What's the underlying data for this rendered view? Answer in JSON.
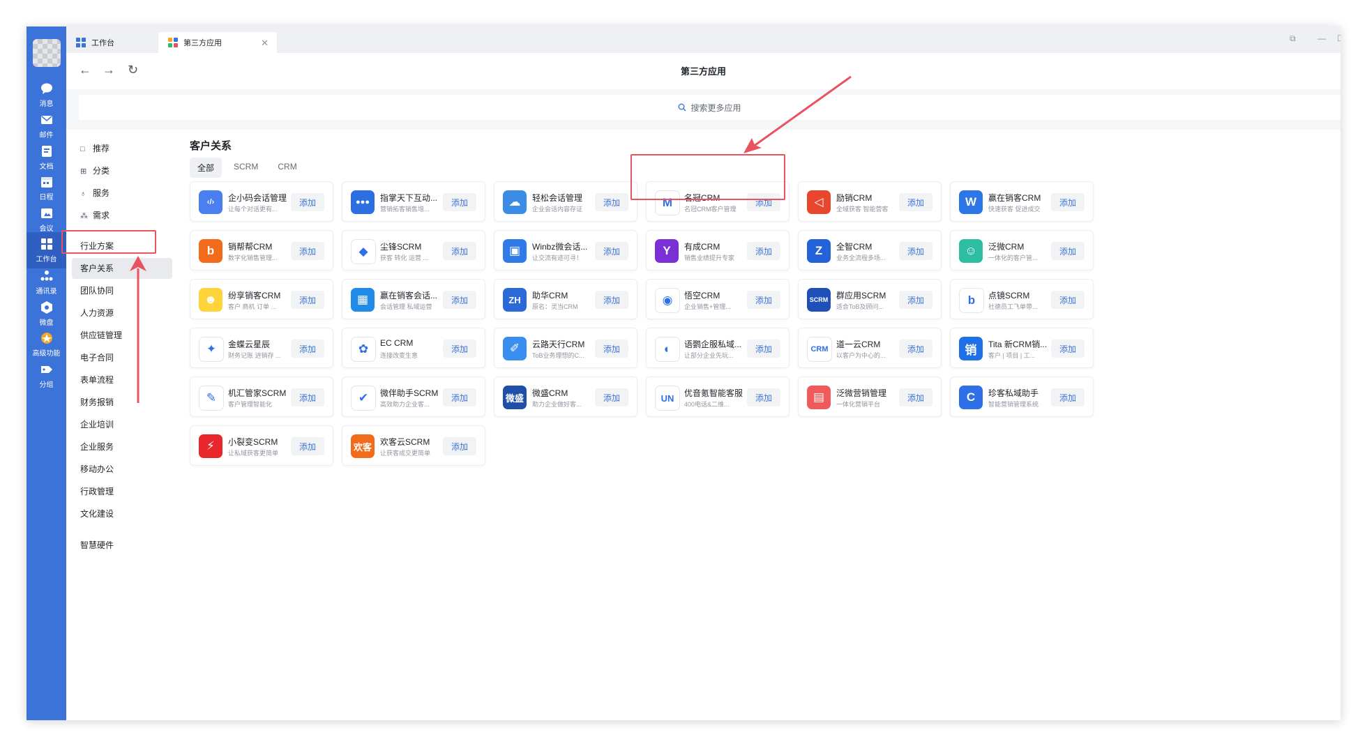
{
  "rail": {
    "items": [
      {
        "label": "消息",
        "icon": "chat-bubble-icon"
      },
      {
        "label": "邮件",
        "icon": "mail-icon"
      },
      {
        "label": "文档",
        "icon": "document-icon"
      },
      {
        "label": "日程",
        "icon": "calendar-icon"
      },
      {
        "label": "会议",
        "icon": "meeting-icon"
      },
      {
        "label": "工作台",
        "icon": "workbench-grid-icon"
      },
      {
        "label": "通讯录",
        "icon": "contacts-icon"
      },
      {
        "label": "微盘",
        "icon": "cloud-drive-icon"
      },
      {
        "label": "高级功能",
        "icon": "premium-icon"
      },
      {
        "label": "分组",
        "icon": "group-tag-icon"
      }
    ],
    "active_index": 5
  },
  "tabs": [
    {
      "label": "工作台"
    },
    {
      "label": "第三方应用",
      "closable": true
    }
  ],
  "window_controls": {
    "restore": "⧉",
    "minimize": "—",
    "maximize": "☐"
  },
  "nav": {
    "back": "←",
    "forward": "→",
    "refresh": "↻",
    "title": "第三方应用"
  },
  "search": {
    "placeholder": "搜索更多应用"
  },
  "sidebar": {
    "top_items": [
      {
        "label": "推荐",
        "icon": "□"
      },
      {
        "label": "分类",
        "icon": "⊞"
      },
      {
        "label": "服务",
        "icon": "♁"
      },
      {
        "label": "需求",
        "icon": "⁂"
      }
    ],
    "categories": [
      "行业方案",
      "客户关系",
      "团队协同",
      "人力资源",
      "供应链管理",
      "电子合同",
      "表单流程",
      "财务报销",
      "企业培训",
      "企业服务",
      "移动办公",
      "行政管理",
      "文化建设"
    ],
    "bottom_item": "智慧硬件",
    "active_category": "客户关系"
  },
  "main": {
    "title": "客户关系",
    "filters": [
      "全部",
      "SCRM",
      "CRM"
    ],
    "active_filter": "全部",
    "add_label": "添加",
    "apps": [
      {
        "name": "企小码会话管理",
        "desc": "让每个对话更有...",
        "color": "#4a7ff0",
        "glyph": "‹/›"
      },
      {
        "name": "指掌天下互动...",
        "desc": "营销拓客销售增...",
        "color": "#2c6fe0",
        "glyph": "●●●"
      },
      {
        "name": "轻松会话管理",
        "desc": "企业会话内容存证",
        "color": "#3b8ce6",
        "glyph": "☁"
      },
      {
        "name": "名冠CRM",
        "desc": "名冠CRM客户管理",
        "color": "#ffffff",
        "glyph": "M"
      },
      {
        "name": "励销CRM",
        "desc": "全域获客 智能营客",
        "color": "#e8472d",
        "glyph": "◁"
      },
      {
        "name": "赢在销客CRM",
        "desc": "快速获客 促进成交",
        "color": "#2c76e8",
        "glyph": "W"
      },
      {
        "name": "销帮帮CRM",
        "desc": "数字化销售管理...",
        "color": "#f26b1d",
        "glyph": "b"
      },
      {
        "name": "尘锋SCRM",
        "desc": "获客 转化 运营 ...",
        "color": "#ffffff",
        "glyph": "◆"
      },
      {
        "name": "Winbz微会话...",
        "desc": "让交流有迹可寻！",
        "color": "#2f7be8",
        "glyph": "▣"
      },
      {
        "name": "有成CRM",
        "desc": "销售业绩提升专家",
        "color": "#7b2fd6",
        "glyph": "Y"
      },
      {
        "name": "全智CRM",
        "desc": "业务全流程多场...",
        "color": "#2362d9",
        "glyph": "Z"
      },
      {
        "name": "泛微CRM",
        "desc": "一体化的客户管...",
        "color": "#2fbda3",
        "glyph": "☺"
      },
      {
        "name": "纷享销客CRM",
        "desc": "客户 商机 订单 ...",
        "color": "#ffd43b",
        "glyph": "☻"
      },
      {
        "name": "赢在销客会话...",
        "desc": "会话管理 私域运营",
        "color": "#1f8ae8",
        "glyph": "▦"
      },
      {
        "name": "助华CRM",
        "desc": "原名：灵当CRM",
        "color": "#2b6ad9",
        "glyph": "ZH"
      },
      {
        "name": "悟空CRM",
        "desc": "企业销售+管理...",
        "color": "#ffffff",
        "glyph": "◉"
      },
      {
        "name": "群应用SCRM",
        "desc": "适合ToB及顾问...",
        "color": "#1f4fb8",
        "glyph": "SCRM"
      },
      {
        "name": "点镜SCRM",
        "desc": "社德员工飞单带...",
        "color": "#ffffff",
        "glyph": "b"
      },
      {
        "name": "金蝶云星辰",
        "desc": "财务记账 进销存 ...",
        "color": "#ffffff",
        "glyph": "✦"
      },
      {
        "name": "EC CRM",
        "desc": "连接改变生意",
        "color": "#ffffff",
        "glyph": "✿"
      },
      {
        "name": "云路天行CRM",
        "desc": "ToB业务理想的C...",
        "color": "#3a8ef0",
        "glyph": "✐"
      },
      {
        "name": "语鹦企服私域...",
        "desc": "让部分企业先玩...",
        "color": "#ffffff",
        "glyph": "◐"
      },
      {
        "name": "道一云CRM",
        "desc": "以客户为中心的...",
        "color": "#ffffff",
        "glyph": "CRM"
      },
      {
        "name": "Tita 新CRM销...",
        "desc": "客户 | 项目 | 工...",
        "color": "#1f6fe8",
        "glyph": "销"
      },
      {
        "name": "机汇管家SCRM",
        "desc": "客户管理智能化",
        "color": "#ffffff",
        "glyph": "✎"
      },
      {
        "name": "微伴助手SCRM",
        "desc": "高效助力企业客...",
        "color": "#ffffff",
        "glyph": "✔"
      },
      {
        "name": "微盛CRM",
        "desc": "助力企业做好客...",
        "color": "#1f4fa8",
        "glyph": "微盛"
      },
      {
        "name": "优音氪智能客服",
        "desc": "400电话&二维...",
        "color": "#ffffff",
        "glyph": "UN"
      },
      {
        "name": "泛微营销管理",
        "desc": "一体化营销平台",
        "color": "#f05a5a",
        "glyph": "▤"
      },
      {
        "name": "珍客私域助手",
        "desc": "智能营销管理系统",
        "color": "#2f6fe8",
        "glyph": "C"
      },
      {
        "name": "小裂变SCRM",
        "desc": "让私域获客更简单",
        "color": "#e8272d",
        "glyph": "⚡"
      },
      {
        "name": "欢客云SCRM",
        "desc": "让获客成交更简单",
        "color": "#f26b1d",
        "glyph": "欢客"
      }
    ]
  }
}
